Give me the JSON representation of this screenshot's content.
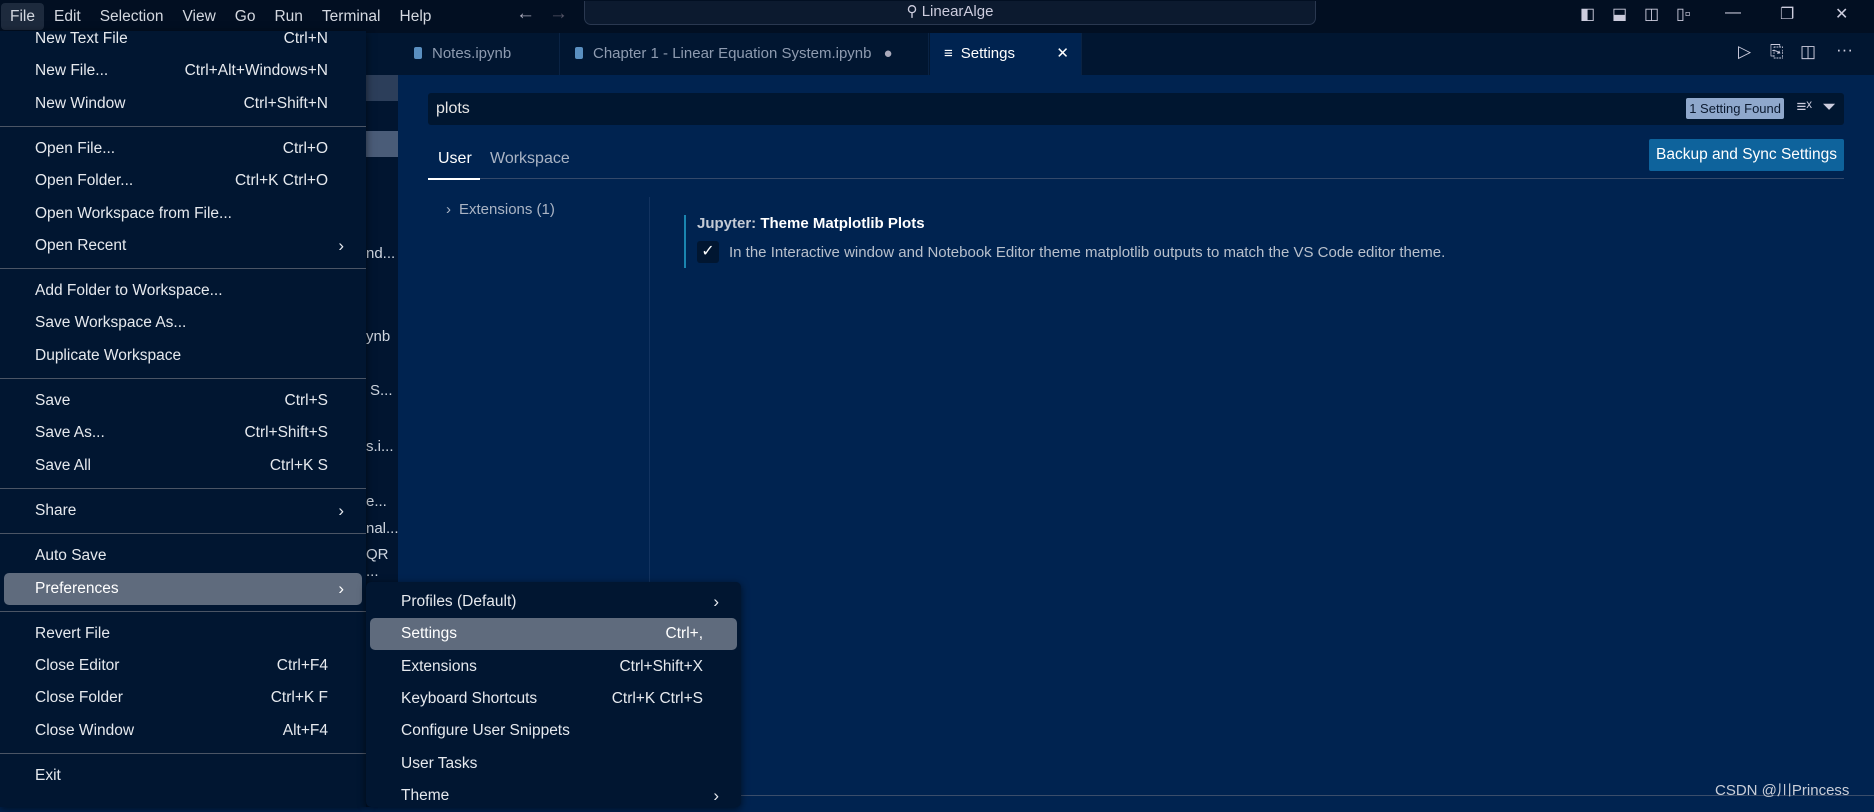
{
  "menubar": [
    "File",
    "Edit",
    "Selection",
    "View",
    "Go",
    "Run",
    "Terminal",
    "Help"
  ],
  "command_center": "LinearAlge",
  "tabs": [
    {
      "label": "Notes.ipynb"
    },
    {
      "label": "Chapter 1 - Linear Equation System.ipynb",
      "dirty": true
    },
    {
      "label": "Settings",
      "active": true
    }
  ],
  "sidebar_fragments": [
    "nd...",
    "ynb",
    "S...",
    "s.i...",
    "e...",
    "nal...",
    "QR ..."
  ],
  "settings": {
    "search_value": "plots",
    "found_badge": "1 Setting Found",
    "scope_tabs": [
      "User",
      "Workspace"
    ],
    "backup_button": "Backup and Sync Settings",
    "toc": "Extensions (1)",
    "setting_category": "Jupyter: ",
    "setting_title": "Theme Matplotlib Plots",
    "setting_description": "In the Interactive window and Notebook Editor theme matplotlib outputs to match the VS Code editor theme.",
    "checked": true
  },
  "file_menu": [
    {
      "label": "New Text File",
      "kb": "Ctrl+N"
    },
    {
      "label": "New File...",
      "kb": "Ctrl+Alt+Windows+N"
    },
    {
      "label": "New Window",
      "kb": "Ctrl+Shift+N"
    },
    {
      "sep": true
    },
    {
      "label": "Open File...",
      "kb": "Ctrl+O"
    },
    {
      "label": "Open Folder...",
      "kb": "Ctrl+K Ctrl+O"
    },
    {
      "label": "Open Workspace from File..."
    },
    {
      "label": "Open Recent",
      "sub": true
    },
    {
      "sep": true
    },
    {
      "label": "Add Folder to Workspace..."
    },
    {
      "label": "Save Workspace As..."
    },
    {
      "label": "Duplicate Workspace"
    },
    {
      "sep": true
    },
    {
      "label": "Save",
      "kb": "Ctrl+S"
    },
    {
      "label": "Save As...",
      "kb": "Ctrl+Shift+S"
    },
    {
      "label": "Save All",
      "kb": "Ctrl+K S"
    },
    {
      "sep": true
    },
    {
      "label": "Share",
      "sub": true
    },
    {
      "sep": true
    },
    {
      "label": "Auto Save"
    },
    {
      "label": "Preferences",
      "sub": true,
      "highlighted": true
    },
    {
      "sep": true
    },
    {
      "label": "Revert File"
    },
    {
      "label": "Close Editor",
      "kb": "Ctrl+F4"
    },
    {
      "label": "Close Folder",
      "kb": "Ctrl+K F"
    },
    {
      "label": "Close Window",
      "kb": "Alt+F4"
    },
    {
      "sep": true
    },
    {
      "label": "Exit"
    }
  ],
  "preferences_menu": [
    {
      "label": "Profiles (Default)",
      "sub": true
    },
    {
      "label": "Settings",
      "kb": "Ctrl+,",
      "highlighted": true
    },
    {
      "label": "Extensions",
      "kb": "Ctrl+Shift+X"
    },
    {
      "label": "Keyboard Shortcuts",
      "kb": "Ctrl+K Ctrl+S"
    },
    {
      "label": "Configure User Snippets"
    },
    {
      "label": "User Tasks"
    },
    {
      "label": "Theme",
      "sub": true
    }
  ],
  "watermark": "CSDN @川Princess"
}
